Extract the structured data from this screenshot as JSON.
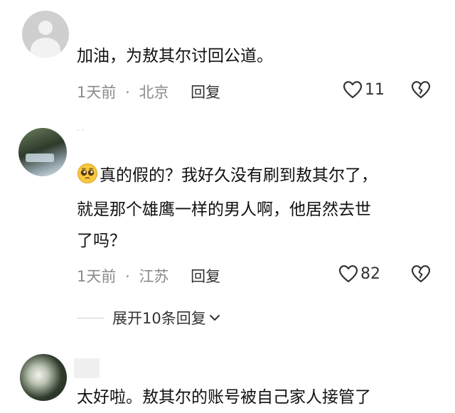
{
  "comments": [
    {
      "text": "加油，为敖其尔讨回公道。",
      "time": "1天前",
      "location": "北京",
      "reply_label": "回复",
      "likes": "11",
      "avatar": "default-avatar-icon"
    },
    {
      "name_mark": "··",
      "emoji": "pleading-face-emoji",
      "lines": [
        "真的假的？我好久没有刷到敖其尔了，",
        "就是那个雄鹰一样的男人啊，他居然去世",
        "了吗？"
      ],
      "time": "1天前",
      "location": "江苏",
      "reply_label": "回复",
      "likes": "82",
      "expand_label": "展开10条回复"
    },
    {
      "text": "太好啦。敖其尔的账号被自己家人接管了"
    }
  ],
  "meta_separator": "·",
  "colors": {
    "primary_text": "#111111",
    "secondary_text": "#8a8a8a",
    "background": "#ffffff"
  }
}
